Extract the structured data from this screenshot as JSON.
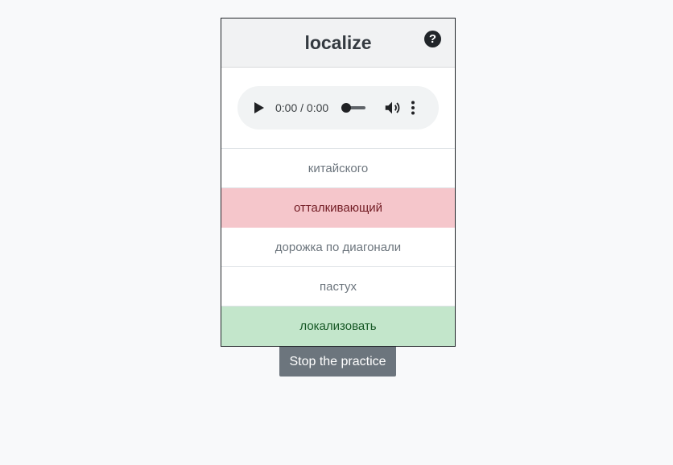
{
  "card": {
    "word": "localize",
    "help_icon": "question-circle-icon"
  },
  "audio": {
    "time": "0:00 / 0:00",
    "play_icon": "play-icon",
    "volume_icon": "volume-icon",
    "more_icon": "more-vertical-icon",
    "progress_fraction": 0
  },
  "options": [
    {
      "label": "китайского",
      "state": "neutral"
    },
    {
      "label": "отталкивающий",
      "state": "wrong"
    },
    {
      "label": "дорожка по диагонали",
      "state": "neutral"
    },
    {
      "label": "пастух",
      "state": "neutral"
    },
    {
      "label": "локализовать",
      "state": "correct"
    }
  ],
  "actions": {
    "stop_label": "Stop the practice"
  },
  "colors": {
    "wrong_bg": "#f5c6cb",
    "correct_bg": "#c3e6cb",
    "stop_button_bg": "#6c757d"
  }
}
